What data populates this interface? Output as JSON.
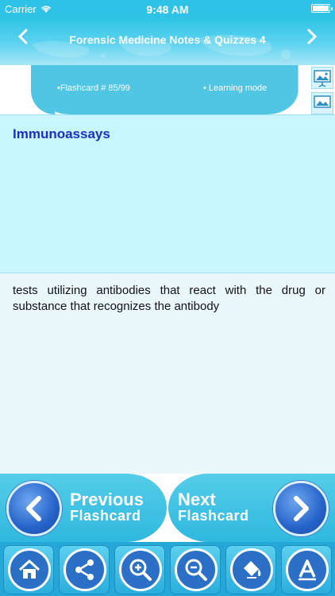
{
  "status_bar": {
    "carrier": "Carrier",
    "time": "9:48 AM"
  },
  "header": {
    "title": "Forensic Medicine Notes & Quizzes 4",
    "prev_icon": "chevron-left-icon",
    "next_icon": "chevron-right-icon"
  },
  "info": {
    "flashcard_label": "•Flashcard #  85/99",
    "mode_label": "• Learning mode"
  },
  "card": {
    "term": "Immunoassays",
    "definition": "tests utilizing antibodies that react with the drug or substance that recognizes the antibody"
  },
  "navigation": {
    "previous_word": "Previous",
    "previous_sub": "Flashcard",
    "next_word": "Next",
    "next_sub": "Flashcard"
  },
  "toolbar": {
    "icons": [
      "home-icon",
      "share-icon",
      "zoom-in-icon",
      "zoom-out-icon",
      "paint-bucket-icon",
      "font-icon"
    ]
  },
  "colors": {
    "accent": "#2ec3e6",
    "question_bg": "#c7f6fd",
    "term_color": "#1b2fc6"
  }
}
